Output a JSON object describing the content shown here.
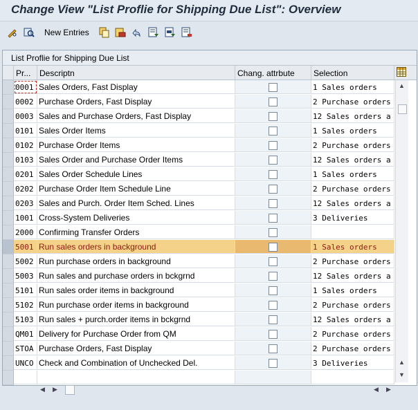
{
  "window": {
    "title": "Change View \"List Proflie for Shipping Due List\": Overview"
  },
  "toolbar": {
    "new_entries_label": "New Entries",
    "icons": [
      "pencil-glasses-icon",
      "find-icon",
      "copy-icon",
      "delete-icon",
      "undo-icon",
      "select-all-icon",
      "select-block-icon",
      "deselect-all-icon"
    ]
  },
  "panel": {
    "title": "List Proflie for Shipping Due List"
  },
  "table": {
    "headers": {
      "profile": "Pr...",
      "description": "Descriptn",
      "chg_attr": "Chang. attrbute",
      "selection": "Selection"
    },
    "rows": [
      {
        "profile": "0001",
        "description": "Sales Orders, Fast Display",
        "selection": "1 Sales orders"
      },
      {
        "profile": "0002",
        "description": "Purchase Orders, Fast Display",
        "selection": "2 Purchase orders"
      },
      {
        "profile": "0003",
        "description": "Sales and Purchase Orders, Fast Display",
        "selection": "12 Sales orders a"
      },
      {
        "profile": "0101",
        "description": "Sales Order Items",
        "selection": "1 Sales orders"
      },
      {
        "profile": "0102",
        "description": "Purchase Order Items",
        "selection": "2 Purchase orders"
      },
      {
        "profile": "0103",
        "description": "Sales Order and Purchase Order Items",
        "selection": "12 Sales orders a"
      },
      {
        "profile": "0201",
        "description": "Sales Order Schedule Lines",
        "selection": "1 Sales orders"
      },
      {
        "profile": "0202",
        "description": "Purchase Order Item Schedule Line",
        "selection": "2 Purchase orders"
      },
      {
        "profile": "0203",
        "description": "Sales and Purch. Order Item Sched. Lines",
        "selection": "12 Sales orders a"
      },
      {
        "profile": "1001",
        "description": "Cross-System Deliveries",
        "selection": "3 Deliveries"
      },
      {
        "profile": "2000",
        "description": "Confirming Transfer Orders",
        "selection": ""
      },
      {
        "profile": "5001",
        "description": "Run sales orders in background",
        "selection": "1 Sales orders",
        "highlighted": true
      },
      {
        "profile": "5002",
        "description": "Run purchase orders in background",
        "selection": "2 Purchase orders"
      },
      {
        "profile": "5003",
        "description": "Run sales and purchase orders in bckgrnd",
        "selection": "12 Sales orders a"
      },
      {
        "profile": "5101",
        "description": "Run sales order items in background",
        "selection": "1 Sales orders"
      },
      {
        "profile": "5102",
        "description": "Run purchase order items in background",
        "selection": "2 Purchase orders"
      },
      {
        "profile": "5103",
        "description": "Run sales + purch.order items in bckgrnd",
        "selection": "12 Sales orders a"
      },
      {
        "profile": "QM01",
        "description": "Delivery for Purchase Order from QM",
        "selection": "2 Purchase orders"
      },
      {
        "profile": "STOA",
        "description": "Purchase Orders, Fast Display",
        "selection": "2 Purchase orders"
      },
      {
        "profile": "UNCO",
        "description": "Check and Combination of Unchecked Del.",
        "selection": "3 Deliveries"
      },
      {
        "profile": "",
        "description": "",
        "selection": "",
        "empty": true
      }
    ]
  },
  "colors": {
    "highlight_bg": "#f5d28a",
    "highlight_text": "#8b1a10",
    "header_bg": "#e7ebf0"
  }
}
